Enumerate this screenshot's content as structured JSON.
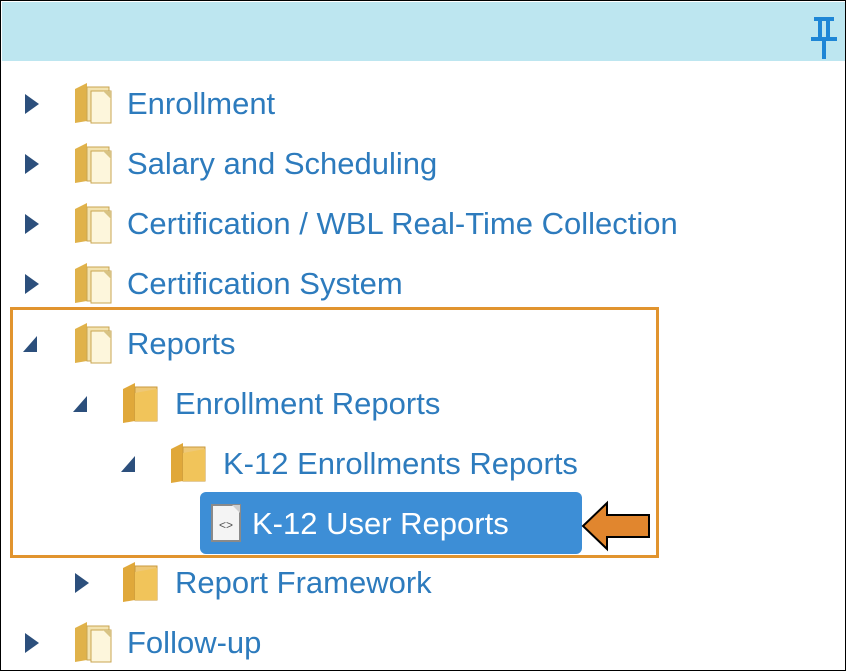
{
  "tree": {
    "items": [
      {
        "label": "Enrollment",
        "state": "collapsed",
        "icon": "folder-icon"
      },
      {
        "label": "Salary and Scheduling",
        "state": "collapsed",
        "icon": "folder-icon"
      },
      {
        "label": "Certification / WBL Real-Time Collection",
        "state": "collapsed",
        "icon": "folder-icon"
      },
      {
        "label": "Certification System",
        "state": "collapsed",
        "icon": "folder-icon"
      },
      {
        "label": "Reports",
        "state": "expanded",
        "icon": "folder-icon"
      },
      {
        "label": "Enrollment Reports",
        "state": "expanded",
        "icon": "folder-icon"
      },
      {
        "label": "K-12 Enrollments Reports",
        "state": "expanded",
        "icon": "folder-icon"
      },
      {
        "label": "K-12 User Reports",
        "state": "selected",
        "icon": "report-icon"
      },
      {
        "label": "Report Framework",
        "state": "collapsed",
        "icon": "folder-icon"
      },
      {
        "label": "Follow-up",
        "state": "collapsed",
        "icon": "folder-icon"
      }
    ]
  },
  "colors": {
    "header_bg": "#bde6f0",
    "link_text": "#2d7bbd",
    "selected_bg": "#3d8ed6",
    "highlight_border": "#e1942e",
    "pin_icon": "#1e86d6"
  },
  "icons": [
    "pin-icon",
    "expand-arrow-icon",
    "collapse-arrow-icon",
    "folder-icon",
    "report-icon",
    "callout-arrow-icon"
  ]
}
